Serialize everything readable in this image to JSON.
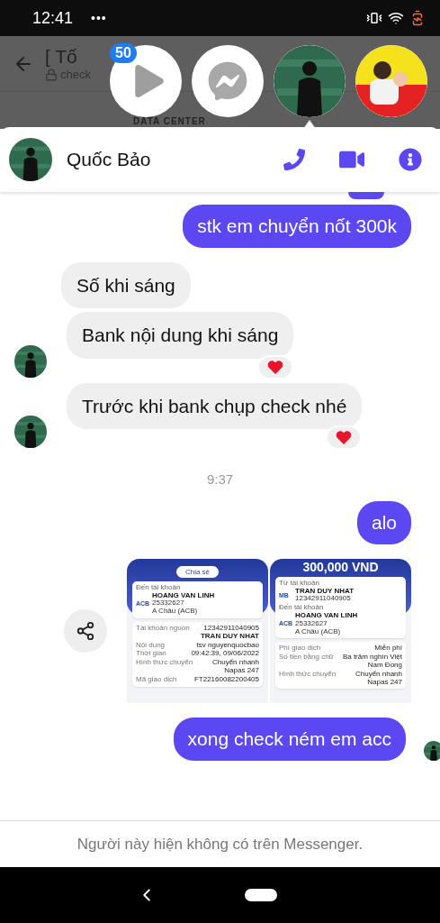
{
  "status_bar": {
    "time": "12:41",
    "more": "•••"
  },
  "background_chat": {
    "title": "[ Tố",
    "subtitle": "check",
    "brand": "DATA CENTER"
  },
  "chat_heads": [
    {
      "kind": "play",
      "badge": "50"
    },
    {
      "kind": "messenger"
    },
    {
      "kind": "avatar",
      "selected": true
    },
    {
      "kind": "avatar_alt",
      "selected": false
    }
  ],
  "header": {
    "name": "Quốc Bảo"
  },
  "messages": [
    {
      "kind": "outgoing",
      "text": "stk em chuyển nốt 300k"
    },
    {
      "kind": "incoming",
      "text": "Số khi sáng",
      "show_avatar": false,
      "reacted": false
    },
    {
      "kind": "incoming",
      "text": "Bank nội dung khi sáng",
      "show_avatar": true,
      "reacted": true
    },
    {
      "kind": "incoming",
      "text": "Trước khi bank chụp check nhé",
      "show_avatar": true,
      "reacted": true
    },
    {
      "kind": "time",
      "text": "9:37"
    },
    {
      "kind": "outgoing",
      "text": "alo"
    },
    {
      "kind": "images",
      "receipts": [
        {
          "kind": "shared",
          "share_label": "Chia sẻ",
          "accounts": [
            {
              "label": "Đến tài khoản",
              "logo": "ACB",
              "name": "HOANG VAN LINH",
              "number": "25332627",
              "bank": "A Châu (ACB)"
            }
          ],
          "rows": [
            {
              "label": "Tài khoản nguồn",
              "value": "12342911040905",
              "value_bold": "TRAN DUY NHAT"
            },
            {
              "label": "Nội dung",
              "value": "tsv nguyenquocbao"
            },
            {
              "label": "Thời gian",
              "value": "09:42:39, 09/06/2022"
            },
            {
              "label": "Hình thức chuyển",
              "value": "Chuyển nhanh Napas 247"
            },
            {
              "label": "Mã giao dịch",
              "value": "FT22160082200405"
            }
          ]
        },
        {
          "kind": "amount",
          "amount": "300,000 VND",
          "accounts": [
            {
              "label": "Từ tài khoản",
              "logo": "MB",
              "name": "TRAN DUY NHAT",
              "number": "12342911040905"
            },
            {
              "label": "Đến tài khoản",
              "logo": "ACB",
              "name": "HOANG VAN LINH",
              "number": "25332627",
              "bank": "A Châu (ACB)"
            }
          ],
          "rows": [
            {
              "label": "Phí giao dịch",
              "value": "Miễn phí"
            },
            {
              "label": "Số tiền bằng chữ",
              "value": "Ba trăm nghìn Việt Nam Đồng"
            },
            {
              "label": "Hình thức chuyển",
              "value": "Chuyển nhanh Napas 247"
            }
          ]
        }
      ]
    },
    {
      "kind": "outgoing",
      "text": "xong check ném em acc",
      "seen_avatar": true
    }
  ],
  "footer": {
    "text": "Người này hiện không có trên Messenger."
  }
}
